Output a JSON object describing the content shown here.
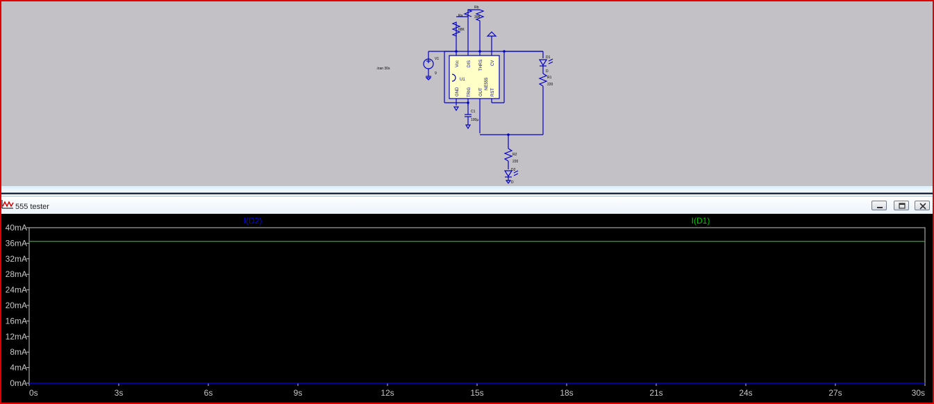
{
  "schematic": {
    "spice_directive": ".tran 30s",
    "ic": {
      "pins_top": [
        "Vcc",
        "DIS",
        "THRS",
        "CV"
      ],
      "pins_bottom": [
        "GND",
        "TRIG",
        "OUT",
        "RST"
      ],
      "part": "NE555",
      "ref": "U1"
    },
    "components": {
      "v1_name": "V1",
      "v1_value": "9",
      "ra_name": "Ra",
      "ra_value": "68K",
      "rb_name": "Rb",
      "rb_value": "39K",
      "c1_name": "C1",
      "c1_value": "100µ",
      "d1_name": "D1",
      "d1_part": "D",
      "r1_name": "R1",
      "r1_value": "220",
      "r2_name": "R2",
      "r2_value": "220",
      "d2_name": "D2",
      "d2_part": "D"
    }
  },
  "plot_window": {
    "title": "555 tester",
    "icon": "waveform-icon",
    "buttons": [
      "minimize-icon",
      "restore-icon",
      "close-icon"
    ]
  },
  "chart_data": {
    "type": "line",
    "x": [
      0,
      30
    ],
    "series": [
      {
        "name": "I(D2)",
        "color": "#0000ff",
        "values": [
          0,
          0
        ]
      },
      {
        "name": "I(D1)",
        "color": "#00c800",
        "values": [
          36.5,
          36.5
        ]
      }
    ],
    "xticks": [
      "0s",
      "3s",
      "6s",
      "9s",
      "12s",
      "15s",
      "18s",
      "21s",
      "24s",
      "27s",
      "30s"
    ],
    "yticks": [
      "0mA",
      "4mA",
      "8mA",
      "12mA",
      "16mA",
      "20mA",
      "24mA",
      "28mA",
      "32mA",
      "36mA",
      "40mA"
    ],
    "xlim": [
      0,
      30
    ],
    "ylim": [
      0,
      40
    ],
    "grid": false,
    "background": "#000000",
    "axis_color": "#c8c8c8"
  }
}
